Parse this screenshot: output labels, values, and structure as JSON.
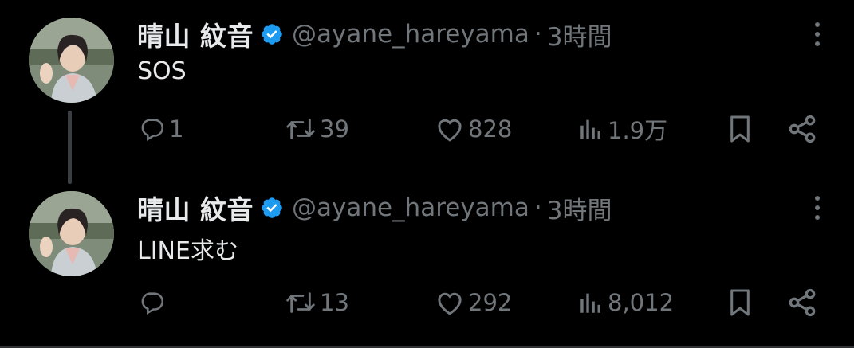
{
  "tweets": [
    {
      "name": "晴山 紋音",
      "handle": "@ayane_hareyama",
      "separator": "·",
      "time": "3時間",
      "text": "SOS",
      "replies": "1",
      "retweets": "39",
      "likes": "828",
      "views": "1.9万"
    },
    {
      "name": "晴山 紋音",
      "handle": "@ayane_hareyama",
      "separator": "·",
      "time": "3時間",
      "text": "LINE求む",
      "replies": "",
      "retweets": "13",
      "likes": "292",
      "views": "8,012"
    }
  ],
  "colors": {
    "background": "#000000",
    "text": "#e7e9ea",
    "muted": "#71767b",
    "verified": "#1d9bf0"
  },
  "icons": [
    "verified-badge-icon",
    "more-icon",
    "reply-icon",
    "retweet-icon",
    "like-icon",
    "views-icon",
    "bookmark-icon",
    "share-icon"
  ]
}
